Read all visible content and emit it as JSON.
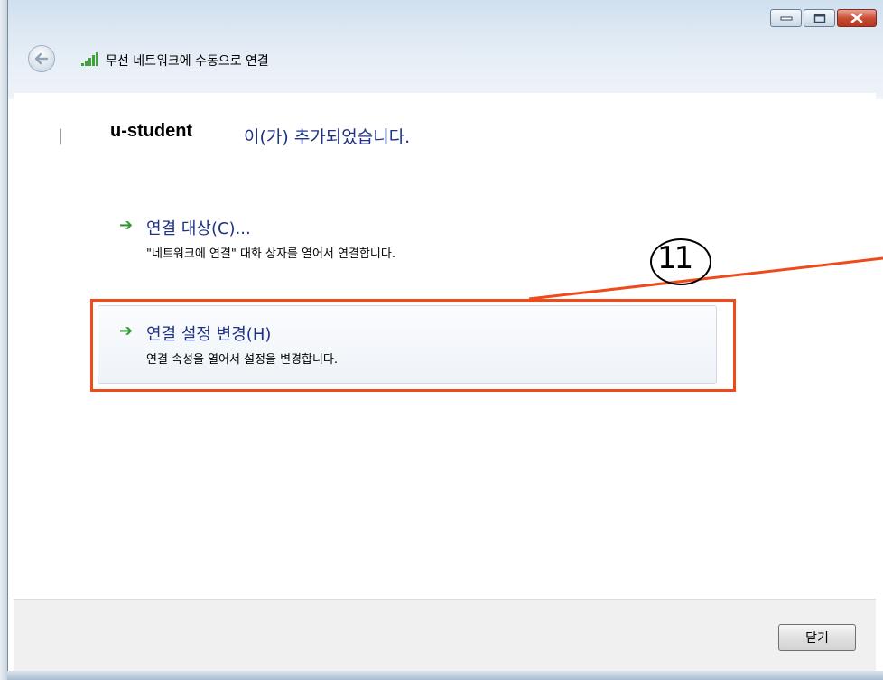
{
  "window": {
    "title": "무선 네트워크에 수동으로 연결"
  },
  "message": {
    "ssid": "u-student",
    "added_text": "이(가) 추가되었습니다."
  },
  "options": [
    {
      "title": "연결 대상(C)...",
      "description": "\"네트워크에 연결\" 대화 상자를 열어서 연결합니다."
    },
    {
      "title": "연결 설정 변경(H)",
      "description": "연결 속성을 열어서 설정을 변경합니다."
    }
  ],
  "annotation": {
    "label": "11",
    "color": "#ef4a1c"
  },
  "footer": {
    "close_label": "닫기"
  },
  "icons": [
    "back-arrow-icon",
    "wireless-signal-icon",
    "minimize-icon",
    "maximize-icon",
    "close-icon",
    "green-arrow-icon"
  ]
}
